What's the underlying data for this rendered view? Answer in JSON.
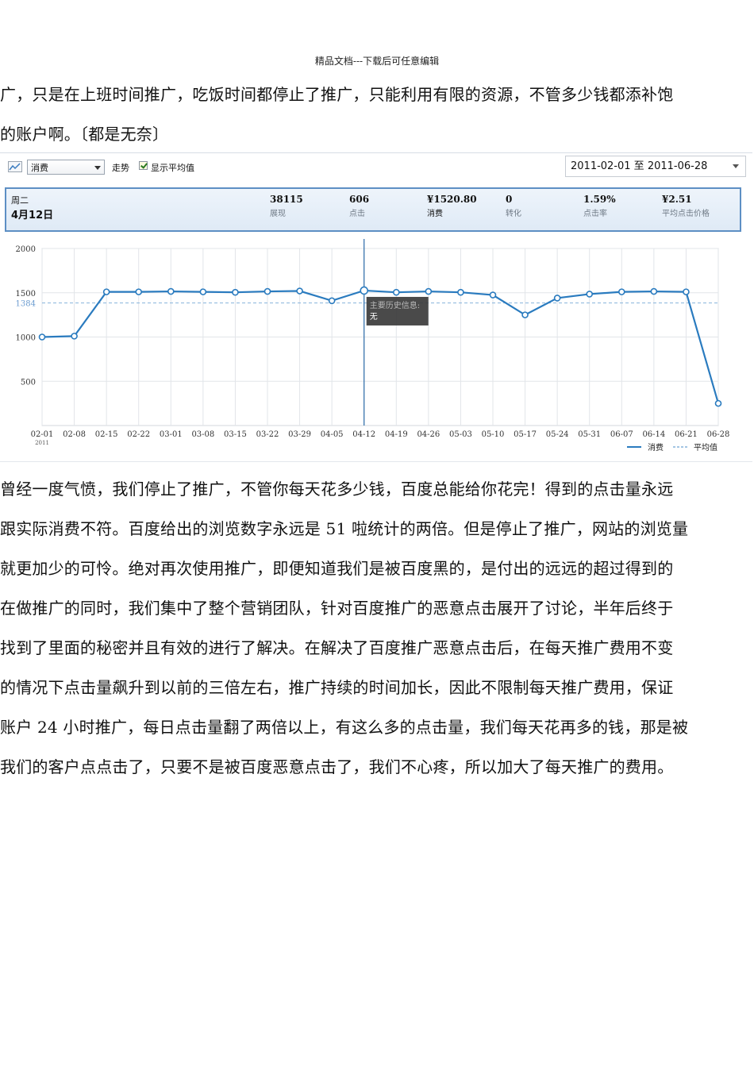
{
  "header": {
    "text": "精品文档---下载后可任意编辑"
  },
  "paragraph1": [
    "广，只是在上班时间推广，吃饭时间都停止了推广，只能利用有限的资源，不管多少钱都添补饱",
    "的账户啊。〔都是无奈〕"
  ],
  "toolbar": {
    "metric_value": "消费",
    "trend_label": "走势",
    "show_avg_label": "显示平均值",
    "date_range": "2011-02-01 至 2011-06-28"
  },
  "summary": {
    "weekday": "周二",
    "date": "4月12日",
    "stats": [
      {
        "value": "38115",
        "label": "展现"
      },
      {
        "value": "606",
        "label": "点击"
      },
      {
        "value": "¥1520.80",
        "label": "消费"
      },
      {
        "value": "0",
        "label": "转化"
      },
      {
        "value": "1.59%",
        "label": "点击率"
      },
      {
        "value": "¥2.51",
        "label": "平均点击价格"
      }
    ]
  },
  "chart_data": {
    "type": "line",
    "categories": [
      "02-01",
      "02-08",
      "02-15",
      "02-22",
      "03-01",
      "03-08",
      "03-15",
      "03-22",
      "03-29",
      "04-05",
      "04-12",
      "04-19",
      "04-26",
      "05-03",
      "05-10",
      "05-17",
      "05-24",
      "05-31",
      "06-07",
      "06-14",
      "06-21",
      "06-28"
    ],
    "year_label": "2011",
    "series": [
      {
        "name": "消费",
        "values": [
          1000,
          1010,
          1510,
          1510,
          1515,
          1510,
          1505,
          1515,
          1520,
          1410,
          1525,
          1505,
          1515,
          1505,
          1475,
          1250,
          1440,
          1485,
          1510,
          1515,
          1510,
          250
        ]
      },
      {
        "name": "平均值",
        "values": [
          1384,
          1384,
          1384,
          1384,
          1384,
          1384,
          1384,
          1384,
          1384,
          1384,
          1384,
          1384,
          1384,
          1384,
          1384,
          1384,
          1384,
          1384,
          1384,
          1384,
          1384,
          1384
        ]
      }
    ],
    "y_ticks": [
      500,
      1000,
      1500,
      2000
    ],
    "avg_label": "1384",
    "ylim": [
      0,
      2000
    ],
    "grid": true,
    "legend_position": "bottom-right",
    "highlight_index": 10,
    "tooltip": {
      "title": "主要历史信息:",
      "body": "无"
    },
    "colors": {
      "line": "#2a7bbf",
      "avg": "#86b3dc",
      "grid": "#e2e5e9",
      "crosshair": "#2a6aa8"
    }
  },
  "paragraph2": [
    "曾经一度气愤，我们停止了推广，不管你每天花多少钱，百度总能给你花完！得到的点击量永远",
    "跟实际消费不符。百度给出的浏览数字永远是 51 啦统计的两倍。但是停止了推广，网站的浏览量",
    "就更加少的可怜。绝对再次使用推广，即便知道我们是被百度黑的，是付出的远远的超过得到的",
    "在做推广的同时，我们集中了整个营销团队，针对百度推广的恶意点击展开了讨论，半年后终于",
    "找到了里面的秘密并且有效的进行了解决。在解决了百度推广恶意点击后，在每天推广费用不变",
    "的情况下点击量飙升到以前的三倍左右，推广持续的时间加长，因此不限制每天推广费用，保证",
    "账户 24 小时推广，每日点击量翻了两倍以上，有这么多的点击量，我们每天花再多的钱，那是被",
    "我们的客户点点击了，只要不是被百度恶意点击了，我们不心疼，所以加大了每天推广的费用。"
  ]
}
